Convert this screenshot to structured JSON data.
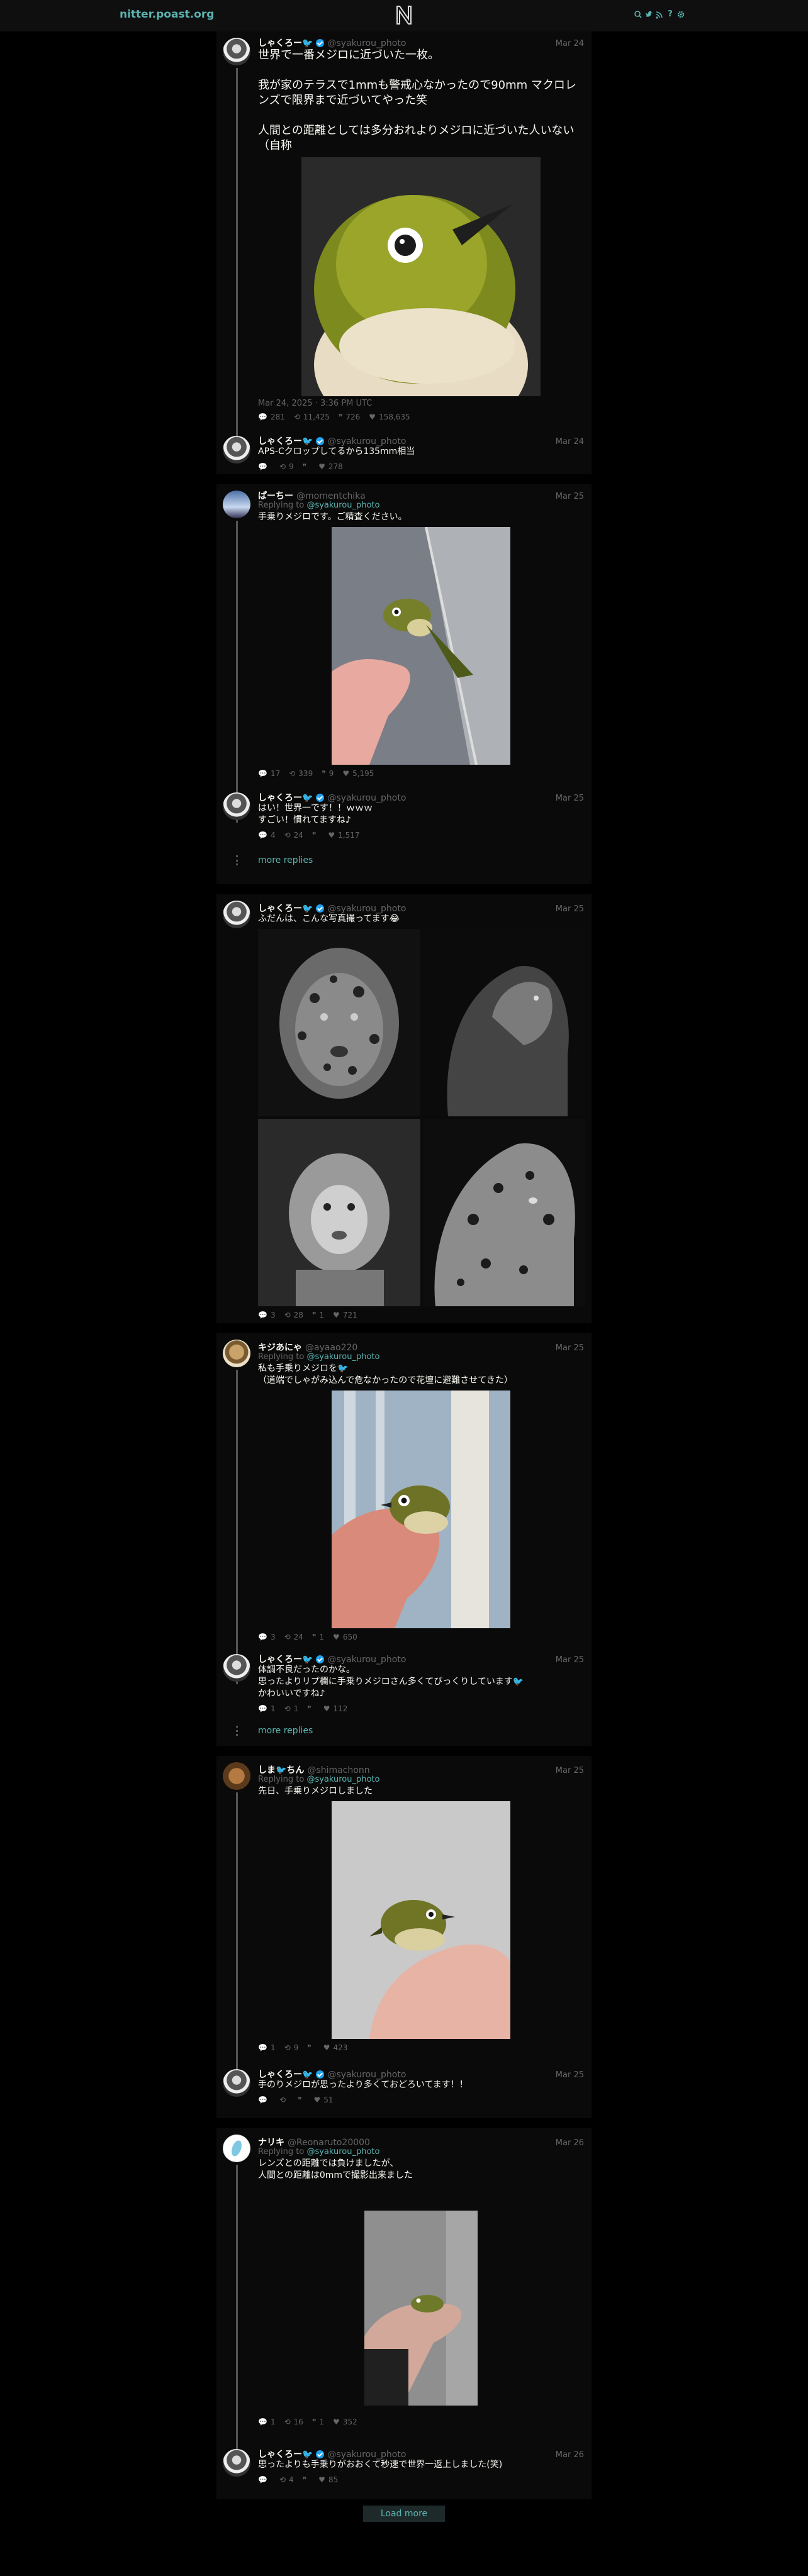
{
  "nav": {
    "brand": "nitter.poast.org",
    "logo_letter": "N"
  },
  "threads": [
    {
      "main": {
        "fullname": "しゃくろー🐦",
        "username": "@syakurou_photo",
        "date": "Mar 24",
        "text": "世界で一番メジロに近づいた一枚。\n\n我が家のテラスで1mmも警戒心なかったので90mm マクロレンズで限界まで近づいてやった笑\n\n人間との距離としては多分おれよりメジロに近づいた人いない（自称",
        "published": "Mar 24, 2025 · 3:36 PM UTC",
        "stats": {
          "comments": "281",
          "retweets": "11,425",
          "quotes": "726",
          "likes": "158,635"
        }
      },
      "reply": {
        "fullname": "しゃくろー🐦",
        "username": "@syakurou_photo",
        "date": "Mar 24",
        "text": "APS-Cクロップしてるから135mm相当",
        "stats": {
          "comments": "",
          "retweets": "9",
          "quotes": "",
          "likes": "278"
        }
      }
    },
    {
      "main": {
        "fullname": "ぱーちー",
        "username": "@momentchika",
        "date": "Mar 25",
        "reply_prefix": "Replying to",
        "reply_to": "@syakurou_photo",
        "text": "手乗りメジロです。ご精査ください。",
        "stats": {
          "comments": "17",
          "retweets": "339",
          "quotes": "9",
          "likes": "5,195"
        }
      },
      "reply": {
        "fullname": "しゃくろー🐦",
        "username": "@syakurou_photo",
        "date": "Mar 25",
        "text": "はい！世界一です！！ｗｗｗ\nすごい！慣れてますね♪",
        "stats": {
          "comments": "4",
          "retweets": "24",
          "quotes": "",
          "likes": "1,517"
        }
      },
      "more": "more replies"
    },
    {
      "main": {
        "fullname": "しゃくろー🐦",
        "username": "@syakurou_photo",
        "date": "Mar 25",
        "text": "ふだんは、こんな写真撮ってます😂",
        "stats": {
          "comments": "3",
          "retweets": "28",
          "quotes": "1",
          "likes": "721"
        }
      }
    },
    {
      "main": {
        "fullname": "キジあにゃ",
        "username": "@ayaao220",
        "date": "Mar 25",
        "reply_prefix": "Replying to",
        "reply_to": "@syakurou_photo",
        "text": "私も手乗りメジロを🐦\n（道端でしゃがみ込んで危なかったので花壇に避難させてきた）",
        "stats": {
          "comments": "3",
          "retweets": "24",
          "quotes": "1",
          "likes": "650"
        }
      },
      "reply": {
        "fullname": "しゃくろー🐦",
        "username": "@syakurou_photo",
        "date": "Mar 25",
        "text": "体調不良だったのかな。\n思ったよりリプ欄に手乗りメジロさん多くてびっくりしています🐦\nかわいいですね♪",
        "stats": {
          "comments": "1",
          "retweets": "1",
          "quotes": "",
          "likes": "112"
        }
      },
      "more": "more replies"
    },
    {
      "main": {
        "fullname": "しま🐦ちん",
        "username": "@shimachonn",
        "date": "Mar 25",
        "reply_prefix": "Replying to",
        "reply_to": "@syakurou_photo",
        "text": "先日、手乗りメジロしました",
        "stats": {
          "comments": "1",
          "retweets": "9",
          "quotes": "",
          "likes": "423"
        }
      },
      "reply": {
        "fullname": "しゃくろー🐦",
        "username": "@syakurou_photo",
        "date": "Mar 25",
        "text": "手のりメジロが思ったより多くておどろいてます！！",
        "stats": {
          "comments": "",
          "retweets": "",
          "quotes": "",
          "likes": "51"
        }
      }
    },
    {
      "main": {
        "fullname": "ナリキ",
        "username": "@Reonaruto20000",
        "date": "Mar 26",
        "reply_prefix": "Replying to",
        "reply_to": "@syakurou_photo",
        "text": "レンズとの距離では負けましたが、\n人間との距離は0mmで撮影出来ました",
        "stats": {
          "comments": "1",
          "retweets": "16",
          "quotes": "1",
          "likes": "352"
        }
      },
      "reply": {
        "fullname": "しゃくろー🐦",
        "username": "@syakurou_photo",
        "date": "Mar 26",
        "text": "思ったよりも手乗りがおおくて秒速で世界一返上しました(笑)",
        "stats": {
          "comments": "",
          "retweets": "4",
          "quotes": "",
          "likes": "85"
        }
      }
    }
  ],
  "load_more": "Load more",
  "colors": {
    "accent": "#5ab5b2",
    "background": "#000000",
    "panel": "#0a0a0a",
    "muted": "#666666"
  }
}
